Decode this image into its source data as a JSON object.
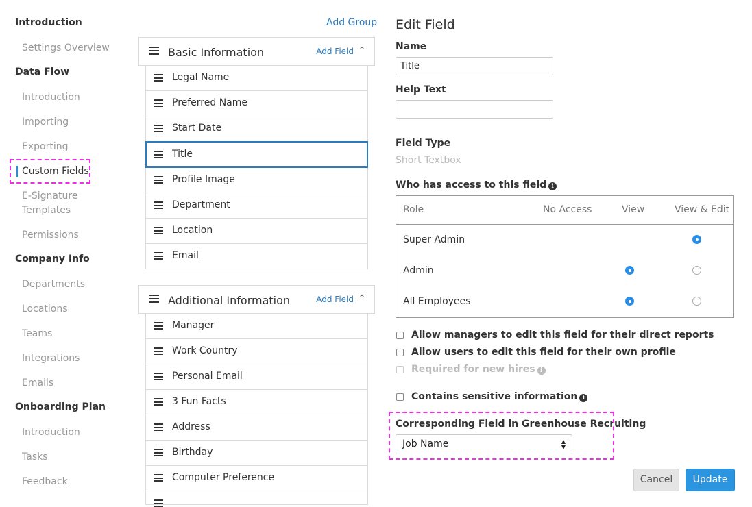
{
  "sidebar": {
    "sections": [
      {
        "heading": "Introduction",
        "items": [
          "Settings Overview"
        ]
      },
      {
        "heading": "Data Flow",
        "items": [
          "Introduction",
          "Importing",
          "Exporting",
          "Custom Fields",
          "E-Signature Templates",
          "Permissions"
        ]
      },
      {
        "heading": "Company Info",
        "items": [
          "Departments",
          "Locations",
          "Teams",
          "Integrations",
          "Emails"
        ]
      },
      {
        "heading": "Onboarding Plan",
        "items": [
          "Introduction",
          "Tasks",
          "Feedback"
        ]
      }
    ],
    "e_signature_line1": "E-Signature",
    "e_signature_line2": "Templates",
    "active_item": "Custom Fields"
  },
  "groups": {
    "add_group_label": "Add Group",
    "basic": {
      "title": "Basic Information",
      "add_field_label": "Add Field",
      "fields": [
        "Legal Name",
        "Preferred Name",
        "Start Date",
        "Title",
        "Profile Image",
        "Department",
        "Location",
        "Email"
      ]
    },
    "additional": {
      "title": "Additional Information",
      "add_field_label": "Add Field",
      "fields": [
        "Manager",
        "Work Country",
        "Personal Email",
        "3 Fun Facts",
        "Address",
        "Birthday",
        "Computer Preference"
      ]
    },
    "selected_field": "Title"
  },
  "edit_field": {
    "title": "Edit Field",
    "name_label": "Name",
    "name_value": "Title",
    "help_text_label": "Help Text",
    "help_text_value": "",
    "field_type_label": "Field Type",
    "field_type_value": "Short Textbox",
    "access_label": "Who has access to this field",
    "access_table": {
      "headers": [
        "Role",
        "No Access",
        "View",
        "View & Edit"
      ],
      "rows": [
        {
          "role": "Super Admin",
          "selection": "View & Edit"
        },
        {
          "role": "Admin",
          "selection": "View"
        },
        {
          "role": "All Employees",
          "selection": "View"
        }
      ]
    },
    "checkboxes": [
      {
        "label": "Allow managers to edit this field for their direct reports",
        "checked": false,
        "disabled": false
      },
      {
        "label": "Allow users to edit this field for their own profile",
        "checked": false,
        "disabled": false
      },
      {
        "label": "Required for new hires",
        "checked": false,
        "disabled": true
      },
      {
        "label": "Contains sensitive information",
        "checked": false,
        "disabled": false
      }
    ],
    "greenhouse_label": "Corresponding Field in Greenhouse Recruiting",
    "greenhouse_value": "Job Name",
    "cancel_label": "Cancel",
    "update_label": "Update"
  },
  "colors": {
    "accent_blue": "#2a7bbf",
    "button_blue": "#2b95e0",
    "radio_blue": "#2a8ee6",
    "highlight_magenta": "#ec2ee8"
  }
}
